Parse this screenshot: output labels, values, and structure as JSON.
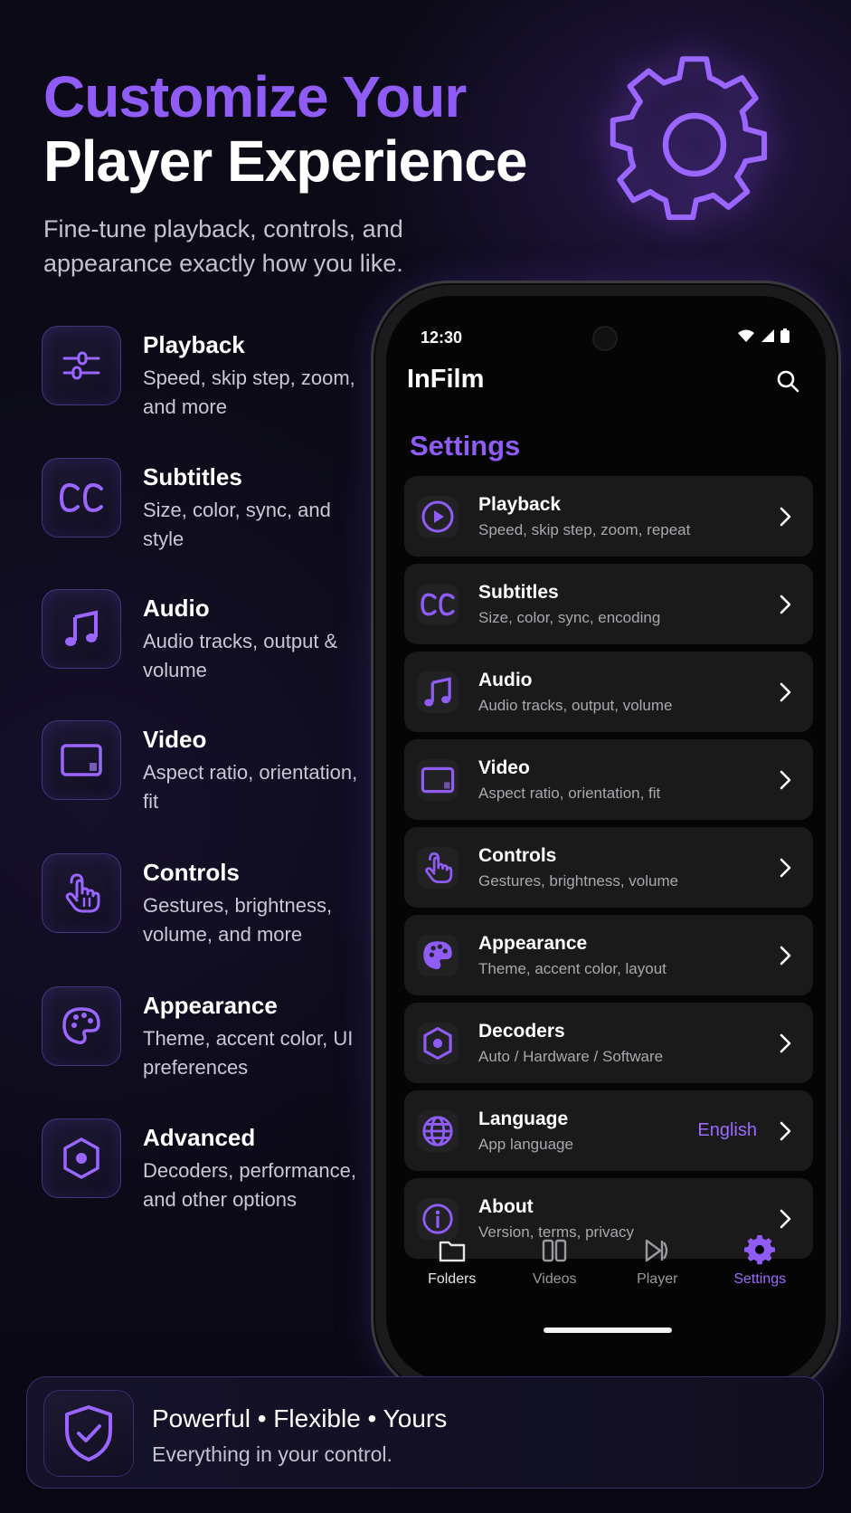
{
  "hero": {
    "title_line1": "Customize Your",
    "title_line2": "Player Experience",
    "subtitle": "Fine-tune playback, controls, and appearance exactly how you like.",
    "gear_icon": "gear-icon"
  },
  "features": [
    {
      "icon": "sliders-icon",
      "title": "Playback",
      "desc": "Speed, skip step, zoom, and more"
    },
    {
      "icon": "cc-icon",
      "title": "Subtitles",
      "desc": "Size, color, sync, and style"
    },
    {
      "icon": "music-note-icon",
      "title": "Audio",
      "desc": "Audio tracks, output & volume"
    },
    {
      "icon": "video-frame-icon",
      "title": "Video",
      "desc": "Aspect ratio, orientation, fit"
    },
    {
      "icon": "hand-tap-icon",
      "title": "Controls",
      "desc": "Gestures, brightness, volume, and more"
    },
    {
      "icon": "palette-icon",
      "title": "Appearance",
      "desc": "Theme, accent color, UI preferences"
    },
    {
      "icon": "hexagon-icon",
      "title": "Advanced",
      "desc": "Decoders, performance, and other options"
    }
  ],
  "phone": {
    "status_time": "12:30",
    "app_title": "InFilm",
    "section_title": "Settings",
    "rows": [
      {
        "icon": "play-circle-icon",
        "title": "Playback",
        "subtitle": "Speed, skip step, zoom, repeat",
        "value": ""
      },
      {
        "icon": "cc-icon",
        "title": "Subtitles",
        "subtitle": "Size, color, sync, encoding",
        "value": ""
      },
      {
        "icon": "music-note-icon",
        "title": "Audio",
        "subtitle": "Audio tracks, output, volume",
        "value": ""
      },
      {
        "icon": "video-frame-icon",
        "title": "Video",
        "subtitle": "Aspect ratio, orientation, fit",
        "value": ""
      },
      {
        "icon": "hand-tap-icon",
        "title": "Controls",
        "subtitle": "Gestures, brightness, volume",
        "value": ""
      },
      {
        "icon": "palette-icon",
        "title": "Appearance",
        "subtitle": "Theme, accent color, layout",
        "value": ""
      },
      {
        "icon": "hexagon-icon",
        "title": "Decoders",
        "subtitle": "Auto / Hardware / Software",
        "value": ""
      },
      {
        "icon": "globe-icon",
        "title": "Language",
        "subtitle": "App language",
        "value": "English"
      },
      {
        "icon": "info-icon",
        "title": "About",
        "subtitle": "Version, terms, privacy",
        "value": ""
      }
    ],
    "nav": [
      {
        "icon": "folder-icon",
        "label": "Folders"
      },
      {
        "icon": "videos-icon",
        "label": "Videos"
      },
      {
        "icon": "player-icon",
        "label": "Player"
      },
      {
        "icon": "gear-icon",
        "label": "Settings",
        "active": true
      }
    ]
  },
  "footer": {
    "icon": "shield-check-icon",
    "title": "Powerful  •  Flexible  •  Yours",
    "subtitle": "Everything in your control."
  },
  "colors": {
    "accent": "#8f5cf6",
    "accent_light": "#9b6bff",
    "background": "#0b0a16",
    "card": "#1a1a1b"
  }
}
